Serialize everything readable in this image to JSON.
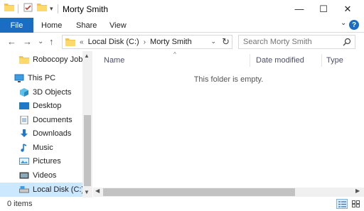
{
  "window": {
    "title": "Morty Smith",
    "controls": {
      "minimize": "—",
      "maximize": "☐",
      "close": "✕"
    }
  },
  "ribbon": {
    "tabs": [
      "File",
      "Home",
      "Share",
      "View"
    ],
    "help": "?",
    "expand": "⌄"
  },
  "address": {
    "overflow": "«",
    "crumbs": [
      "Local Disk (C:)",
      "Morty Smith"
    ],
    "separator": "›",
    "refresh": "↻"
  },
  "search": {
    "placeholder": "Search Morty Smith"
  },
  "nav_buttons": {
    "back": "←",
    "forward": "→",
    "recent": "⌄",
    "up": "↑"
  },
  "nav_pane": {
    "items": [
      {
        "label": "Robocopy Job Fi",
        "icon": "folder-icon"
      },
      {
        "label": "This PC",
        "icon": "pc-icon"
      },
      {
        "label": "3D Objects",
        "icon": "cube-icon"
      },
      {
        "label": "Desktop",
        "icon": "desktop-icon"
      },
      {
        "label": "Documents",
        "icon": "documents-icon"
      },
      {
        "label": "Downloads",
        "icon": "download-icon"
      },
      {
        "label": "Music",
        "icon": "music-icon"
      },
      {
        "label": "Pictures",
        "icon": "pictures-icon"
      },
      {
        "label": "Videos",
        "icon": "videos-icon"
      },
      {
        "label": "Local Disk (C:)",
        "icon": "drive-icon"
      }
    ],
    "selected": "Local Disk (C:)"
  },
  "content": {
    "columns": [
      "Name",
      "Date modified",
      "Type"
    ],
    "empty_message": "This folder is empty."
  },
  "status": {
    "item_count": "0 items"
  },
  "colors": {
    "accent": "#1a6dc2",
    "selected": "#cce8ff"
  }
}
